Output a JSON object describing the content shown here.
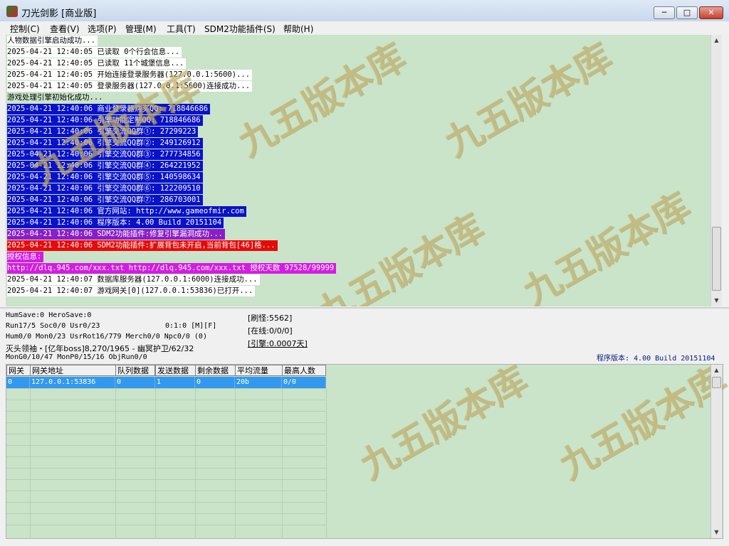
{
  "window": {
    "title": "刀光剑影 [商业版]",
    "min_glyph": "─",
    "max_glyph": "□",
    "close_glyph": "✕"
  },
  "menu": [
    {
      "label": "控制(C)"
    },
    {
      "label": "查看(V)"
    },
    {
      "label": "选项(P)"
    },
    {
      "label": "管理(M)"
    },
    {
      "label": "工具(T)"
    },
    {
      "label": "SDM2功能插件(S)"
    },
    {
      "label": "帮助(H)"
    }
  ],
  "log": [
    {
      "text": "人物数据引擎启动成功...",
      "style": "white"
    },
    {
      "text": "2025-04-21 12:40:05 已读取 0个行会信息...",
      "style": "white"
    },
    {
      "text": "2025-04-21 12:40:05 已读取 11个城堡信息...",
      "style": "white"
    },
    {
      "text": "2025-04-21 12:40:05 开始连接登录服务器(127.0.0.1:5600)...",
      "style": "white"
    },
    {
      "text": "2025-04-21 12:40:05 登录服务器(127.0.0.1:5600)连接成功...",
      "style": "white"
    },
    {
      "text": "游戏处理引擎初始化成功...",
      "style": "green"
    },
    {
      "text": "2025-04-21 12:40:06 商业登录器购买QQ: 718846686",
      "style": "blue"
    },
    {
      "text": "2025-04-21 12:40:06 引擎功能定制QQ: 718846686",
      "style": "blue"
    },
    {
      "text": "2025-04-21 12:40:06 引擎交流QQ群①: 27299223",
      "style": "blue"
    },
    {
      "text": "2025-04-21 12:40:06 引擎交流QQ群②: 249126912",
      "style": "blue"
    },
    {
      "text": "2025-04-21 12:40:06 引擎交流QQ群③: 277734856",
      "style": "blue"
    },
    {
      "text": "2025-04-21 12:40:06 引擎交流QQ群④: 264221952",
      "style": "blue"
    },
    {
      "text": "2025-04-21 12:40:06 引擎交流QQ群⑤: 140598634",
      "style": "blue"
    },
    {
      "text": "2025-04-21 12:40:06 引擎交流QQ群⑥: 122209510",
      "style": "blue"
    },
    {
      "text": "2025-04-21 12:40:06 引擎交流QQ群⑦: 286703001",
      "style": "blue"
    },
    {
      "text": "2025-04-21 12:40:06 官方网站: http://www.gameofmir.com",
      "style": "blue"
    },
    {
      "text": "2025-04-21 12:40:06 程序版本: 4.00 Build 20151104",
      "style": "blue"
    },
    {
      "text": "2025-04-21 12:40:06 SDM2功能插件:修复引擎漏洞成功...",
      "style": "purple"
    },
    {
      "text": "2025-04-21 12:40:06 SDM2功能插件:扩展背包未开启,当前背包[46]格...",
      "style": "red"
    },
    {
      "text": "授权信息:",
      "style": "pink"
    },
    {
      "text": "http://dlq.945.com/xxx.txt http://dlq.945.com/xxx.txt 授权天数 97528/99999",
      "style": "pink"
    },
    {
      "text": "2025-04-21 12:40:07 数据库服务器(127.0.0.1:6000)连接成功...",
      "style": "white"
    },
    {
      "text": "2025-04-21 12:40:07 游戏网关[0](127.0.0.1:53836)已打开...",
      "style": "white"
    }
  ],
  "status": {
    "humsave": "HumSave:0 HeroSave:0",
    "run": "Run17/5 Soc0/0 Usr0/23",
    "cycle": "0:1:0 [M][F]",
    "hum": "Hum0/0 Mon0/23 UsrRot16/779 Merch0/0 Npc0/0 (0)",
    "boss": "灭头领袖・[亿年boss]8,270/1965 - 幽冥护卫/62/32",
    "mon": "MonG0/10/47 MonP0/15/16 ObjRun0/0",
    "refresh": "[刷怪:5562]",
    "online": "[在线:0/0/0]",
    "engine": "[引擎:0.0007天]",
    "version": "程序版本: 4.00 Build 20151104"
  },
  "grid": {
    "headers": [
      "网关",
      "网关地址",
      "队列数据",
      "发送数据",
      "剩余数据",
      "平均流量",
      "最高人数"
    ],
    "rows": [
      [
        "0",
        "127.0.0.1:53836",
        "0",
        "1",
        "0",
        "20b",
        "0/0"
      ]
    ]
  },
  "watermark": {
    "text": "九五版本库",
    "color": "#d2be78"
  },
  "scroll": {
    "up_glyph": "▲",
    "down_glyph": "▼"
  }
}
